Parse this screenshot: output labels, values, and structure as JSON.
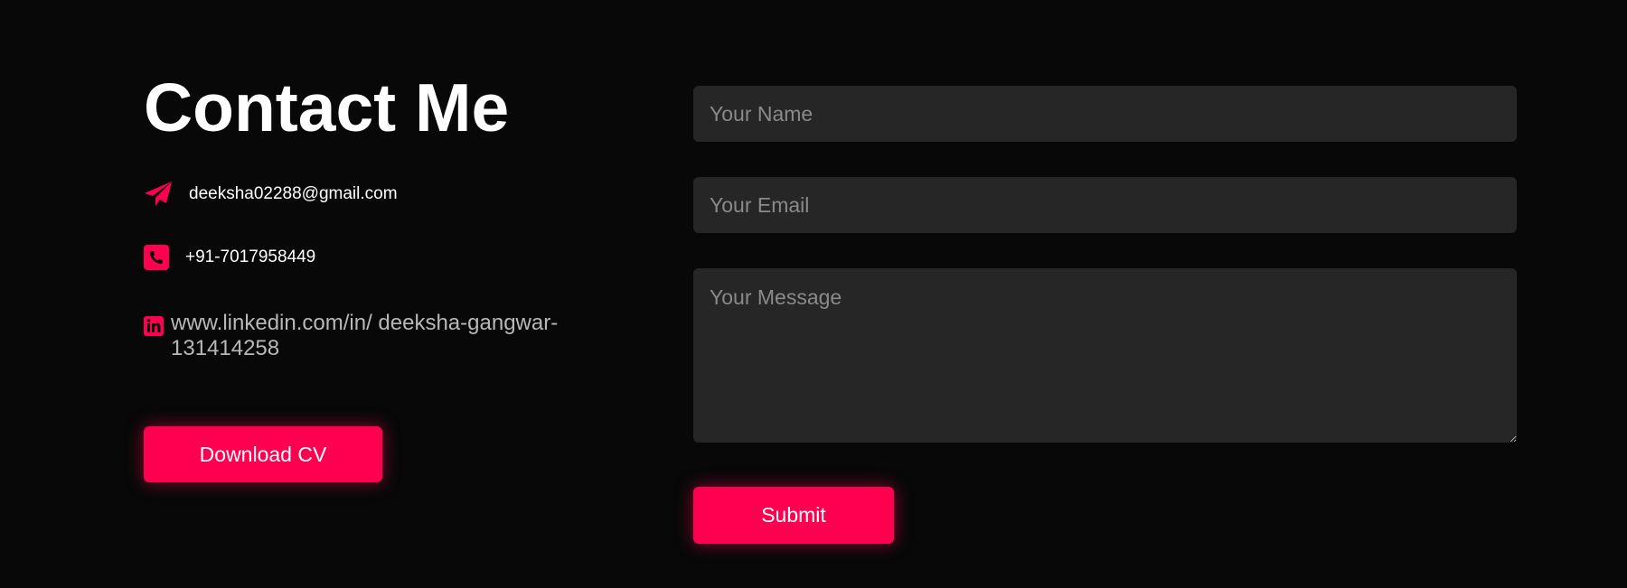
{
  "contact": {
    "title": "Contact Me",
    "email": "deeksha02288@gmail.com",
    "phone": "+91-7017958449",
    "linkedin": "www.linkedin.com/in/ deeksha-gangwar-131414258",
    "download_label": "Download CV",
    "icons": {
      "email": "paper-plane-icon",
      "phone": "phone-square-icon",
      "linkedin": "linkedin-icon"
    }
  },
  "form": {
    "name_placeholder": "Your Name",
    "email_placeholder": "Your Email",
    "message_placeholder": "Your Message",
    "submit_label": "Submit"
  },
  "colors": {
    "background": "#080808",
    "accent": "#ff0050",
    "field_background": "#262626",
    "placeholder": "#8a8a8a",
    "muted_text": "#b8b8b8"
  }
}
